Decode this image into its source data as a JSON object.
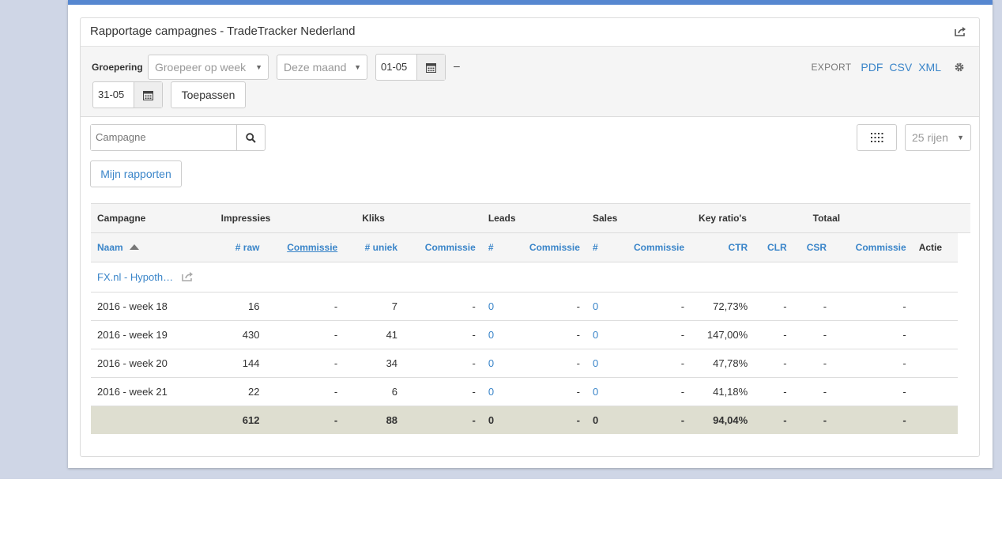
{
  "card": {
    "title": "Rapportage campagnes - TradeTracker Nederland"
  },
  "filters": {
    "groepering_label": "Groepering",
    "groepering_placeholder": "Groepeer op week",
    "period_value": "Deze maand",
    "date_from": "01-05",
    "date_to": "31-05",
    "dash": "–",
    "apply_label": "Toepassen"
  },
  "export": {
    "label": "EXPORT",
    "pdf": "PDF",
    "csv": "CSV",
    "xml": "XML"
  },
  "search": {
    "placeholder": "Campagne"
  },
  "rows_select": "25 rijen",
  "reports_button": "Mijn rapporten",
  "table": {
    "group_headers": [
      "Campagne",
      "Impressies",
      "Kliks",
      "Leads",
      "Sales",
      "Key ratio's",
      "Totaal"
    ],
    "columns": [
      "Naam",
      "# raw",
      "Commissie",
      "# uniek",
      "Commissie",
      "#",
      "Commissie",
      "#",
      "Commissie",
      "CTR",
      "CLR",
      "CSR",
      "Commissie",
      "Actie"
    ],
    "campaign_name": "FX.nl - Hypoth…",
    "rows": [
      [
        "2016 - week 18",
        "16",
        "-",
        "7",
        "-",
        "0",
        "-",
        "0",
        "-",
        "72,73%",
        "-",
        "-",
        "-"
      ],
      [
        "2016 - week 19",
        "430",
        "-",
        "41",
        "-",
        "0",
        "-",
        "0",
        "-",
        "147,00%",
        "-",
        "-",
        "-"
      ],
      [
        "2016 - week 20",
        "144",
        "-",
        "34",
        "-",
        "0",
        "-",
        "0",
        "-",
        "47,78%",
        "-",
        "-",
        "-"
      ],
      [
        "2016 - week 21",
        "22",
        "-",
        "6",
        "-",
        "0",
        "-",
        "0",
        "-",
        "41,18%",
        "-",
        "-",
        "-"
      ]
    ],
    "totals": [
      "612",
      "-",
      "88",
      "-",
      "0",
      "-",
      "0",
      "-",
      "94,04%",
      "-",
      "-",
      "-"
    ]
  },
  "colors": {
    "accent": "#5687d0",
    "link": "#3a85c9",
    "total_bg": "#deded0",
    "page_bg": "#cfd6e6"
  }
}
